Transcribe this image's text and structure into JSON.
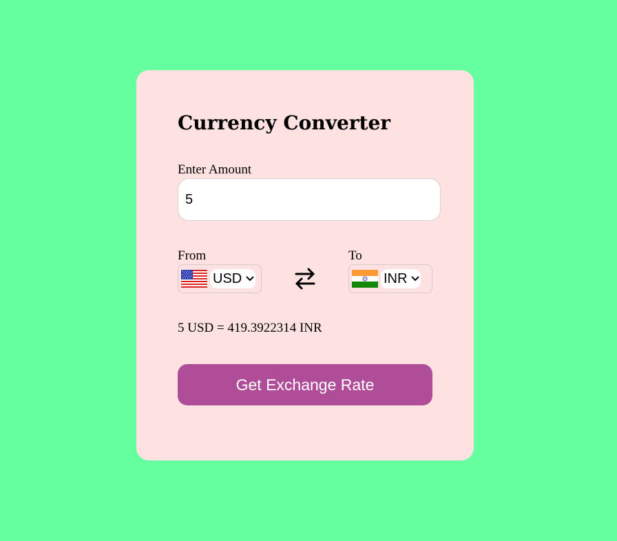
{
  "app": {
    "title": "Currency Converter"
  },
  "amount": {
    "label": "Enter Amount",
    "value": "5"
  },
  "from": {
    "label": "From",
    "currency": "USD",
    "flag_icon": "us-flag-icon"
  },
  "to": {
    "label": "To",
    "currency": "INR",
    "flag_icon": "india-flag-icon"
  },
  "swap_icon": "swap-arrows-icon",
  "result": {
    "text": "5 USD = 419.3922314 INR"
  },
  "button": {
    "label": "Get Exchange Rate"
  },
  "colors": {
    "page_background": "#66ff9f",
    "card_background": "#fde2e1",
    "button_background": "#af4d98",
    "button_text": "#ffffff"
  }
}
